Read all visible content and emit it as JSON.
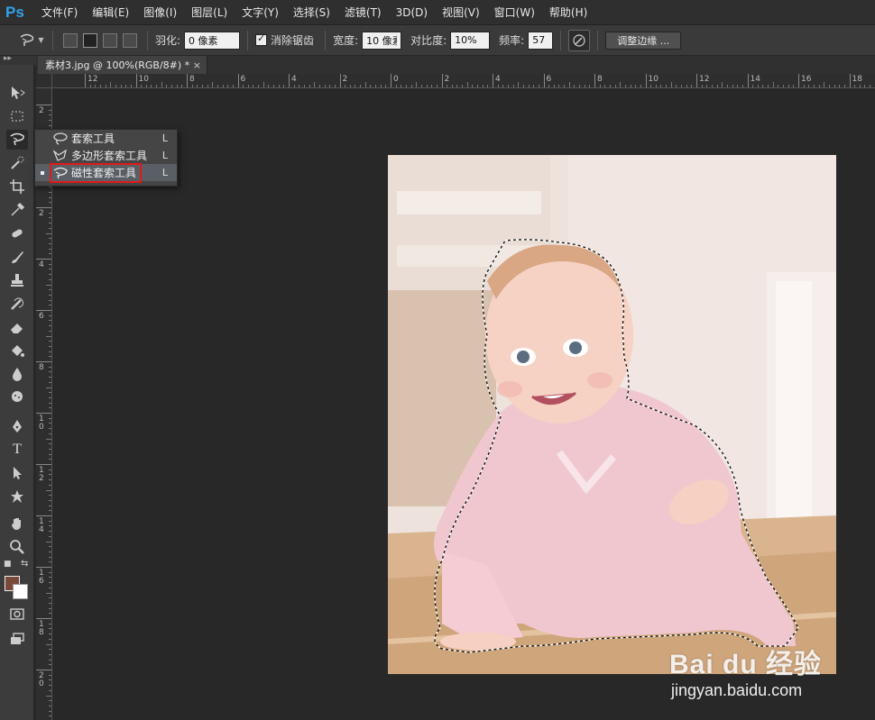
{
  "app": {
    "logo": "Ps",
    "menu": [
      "文件(F)",
      "编辑(E)",
      "图像(I)",
      "图层(L)",
      "文字(Y)",
      "选择(S)",
      "滤镜(T)",
      "3D(D)",
      "视图(V)",
      "窗口(W)",
      "帮助(H)"
    ]
  },
  "options": {
    "feather_label": "羽化:",
    "feather_value": "0 像素",
    "antialias_label": "消除锯齿",
    "antialias_checked": true,
    "width_label": "宽度:",
    "width_value": "10 像素",
    "contrast_label": "对比度:",
    "contrast_value": "10%",
    "frequency_label": "频率:",
    "frequency_value": "57",
    "refine_edge_label": "调整边缘 ..."
  },
  "document": {
    "tab_title": "素材3.jpg @ 100%(RGB/8#) *",
    "tab_close": "×"
  },
  "ruler": {
    "horizontal": [
      "12",
      "10",
      "8",
      "6",
      "4",
      "2",
      "0",
      "2",
      "4",
      "6",
      "8",
      "10",
      "12",
      "14",
      "16",
      "18"
    ],
    "vertical": [
      "2",
      "0",
      "2",
      "4",
      "6",
      "8",
      "10",
      "12",
      "14",
      "16",
      "18",
      "20"
    ]
  },
  "flyout": {
    "items": [
      {
        "label": "套索工具",
        "shortcut": "L",
        "icon": "lasso-icon"
      },
      {
        "label": "多边形套索工具",
        "shortcut": "L",
        "icon": "polygonal-lasso-icon"
      },
      {
        "label": "磁性套索工具",
        "shortcut": "L",
        "icon": "magnetic-lasso-icon"
      }
    ]
  },
  "colors": {
    "foreground": "#7a4a38",
    "background": "#ffffff",
    "highlight": "#e01a1a"
  },
  "watermark": {
    "logo": "Bai du 经验",
    "url": "jingyan.baidu.com"
  }
}
